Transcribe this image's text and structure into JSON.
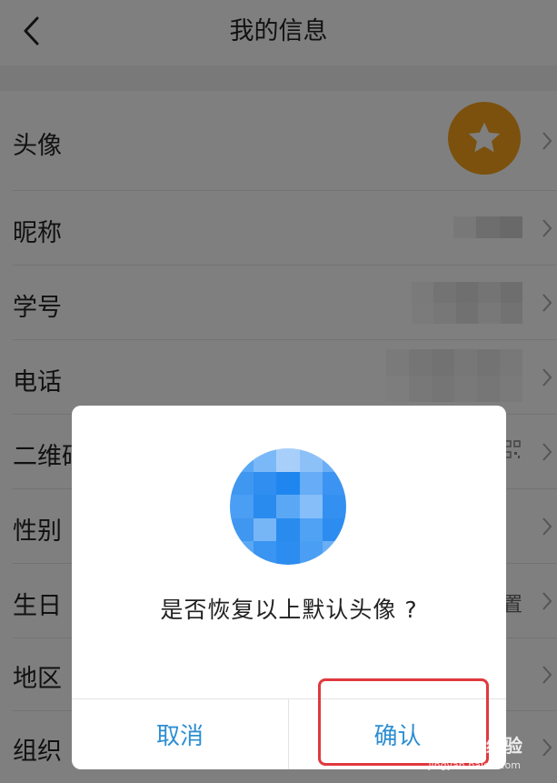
{
  "nav": {
    "title": "我的信息"
  },
  "rows": [
    {
      "label": "头像",
      "icon": "star-icon"
    },
    {
      "label": "昵称"
    },
    {
      "label": "学号"
    },
    {
      "label": "电话"
    },
    {
      "label": "二维码"
    },
    {
      "label": "性别"
    },
    {
      "label": "生日",
      "value": "置"
    },
    {
      "label": "地区"
    },
    {
      "label": "组织"
    }
  ],
  "dialog": {
    "message": "是否恢复以上默认头像 ?",
    "cancel_label": "取消",
    "confirm_label": "确认"
  },
  "watermark": {
    "text": "Baidu经验",
    "sub": "jingyan.baidu.com"
  },
  "colors": {
    "accent": "#2d8fd2",
    "avatar_orange": "#f6a21b",
    "highlight_red": "#e0393e"
  }
}
